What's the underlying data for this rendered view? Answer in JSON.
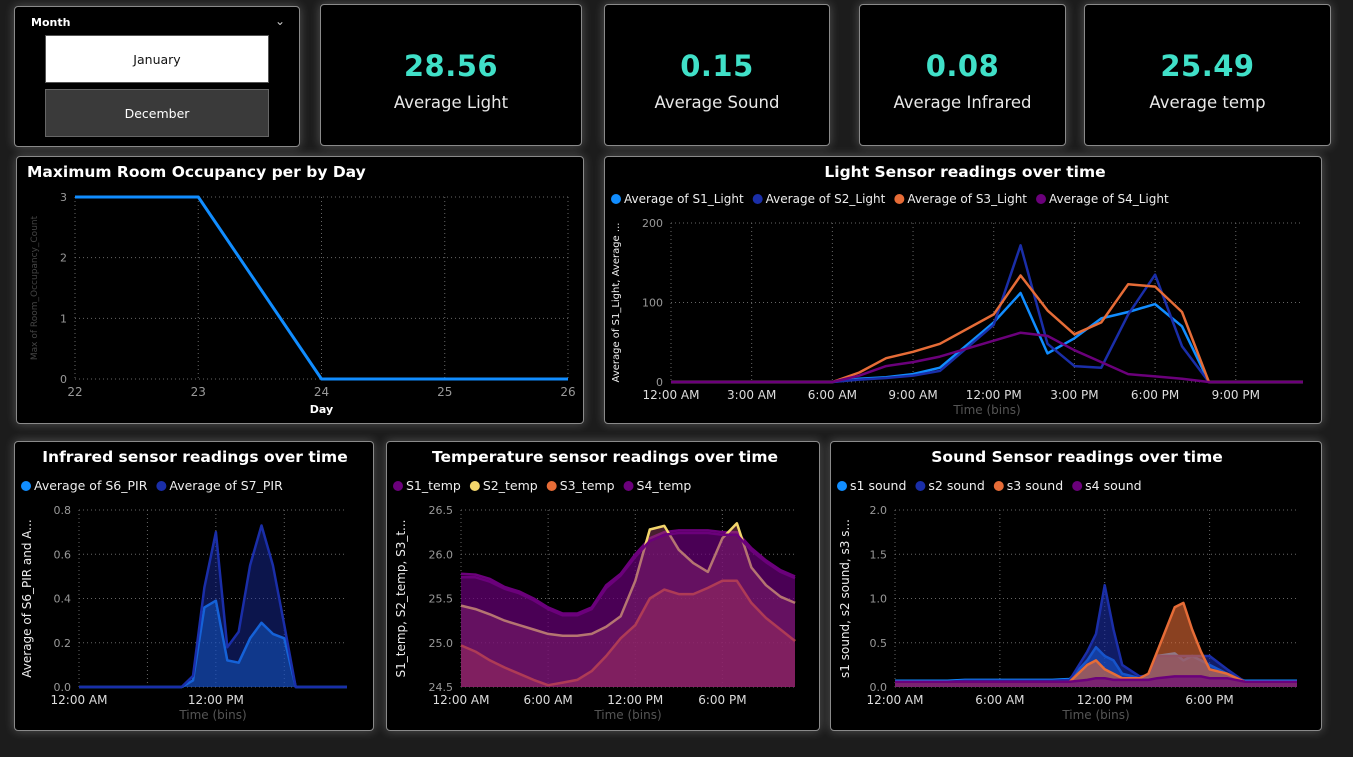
{
  "slicer": {
    "title": "Month",
    "options": [
      "January",
      "December"
    ],
    "selected": "January"
  },
  "kpis": [
    {
      "value": "28.56",
      "label": "Average Light"
    },
    {
      "value": "0.15",
      "label": "Average Sound"
    },
    {
      "value": "0.08",
      "label": "Average Infrared"
    },
    {
      "value": "25.49",
      "label": "Average temp"
    }
  ],
  "colors": {
    "kpi": "#40e0c8",
    "s1": "#118dff",
    "s2": "#1a2ea8",
    "s3": "#e66c37",
    "s4": "#6b007b",
    "temp2": "#f3d66b"
  },
  "chart_data": [
    {
      "type": "line",
      "title": "Maximum Room Occupancy per by Day",
      "xlabel": "Day",
      "ylabel": "Max of Room_Occupancy_Count",
      "x": [
        22,
        23,
        24,
        25,
        26
      ],
      "xlim": [
        22,
        26
      ],
      "ylim": [
        0,
        3
      ],
      "yticks": [
        0,
        1,
        2,
        3
      ],
      "series": [
        {
          "values": [
            3,
            3,
            0,
            0,
            0
          ]
        }
      ],
      "grid": true
    },
    {
      "type": "line",
      "title": "Light Sensor readings over time",
      "xlabel": "Time (bins)",
      "ylabel": "Average of S1_Light, Average ...",
      "xticks": [
        "12:00 AM",
        "3:00 AM",
        "6:00 AM",
        "9:00 AM",
        "12:00 PM",
        "3:00 PM",
        "6:00 PM",
        "9:00 PM"
      ],
      "ylim": [
        0,
        200
      ],
      "yticks": [
        0,
        100,
        200
      ],
      "legend": "top-left",
      "x": [
        0,
        2,
        4,
        6,
        7,
        8,
        9,
        10,
        12,
        13,
        14,
        15,
        16,
        17,
        18,
        19,
        20,
        21,
        22,
        23.5
      ],
      "series": [
        {
          "name": "Average of S1_Light",
          "values": [
            0,
            0,
            0,
            0,
            4,
            6,
            10,
            18,
            75,
            112,
            36,
            55,
            80,
            88,
            98,
            70,
            0,
            0,
            0,
            0
          ]
        },
        {
          "name": "Average of S2_Light",
          "values": [
            0,
            0,
            0,
            0,
            3,
            5,
            8,
            14,
            72,
            172,
            48,
            20,
            18,
            85,
            135,
            45,
            0,
            0,
            0,
            0
          ]
        },
        {
          "name": "Average of S3_Light",
          "values": [
            0,
            0,
            0,
            0,
            12,
            30,
            38,
            48,
            85,
            134,
            90,
            60,
            75,
            123,
            120,
            88,
            0,
            0,
            0,
            0
          ]
        },
        {
          "name": "Average of S4_Light",
          "values": [
            0,
            0,
            0,
            0,
            8,
            20,
            25,
            32,
            52,
            62,
            58,
            40,
            25,
            10,
            7,
            4,
            0,
            0,
            0,
            0
          ]
        }
      ]
    },
    {
      "type": "area",
      "title": "Infrared sensor readings over time",
      "xlabel": "Time (bins)",
      "ylabel": "Average of S6_PIR and A...",
      "xticks": [
        "12:00 AM",
        "12:00 PM"
      ],
      "ylim": [
        0,
        0.8
      ],
      "yticks": [
        0,
        0.2,
        0.4,
        0.6,
        0.8
      ],
      "legend": "top-left",
      "x": [
        0,
        2,
        4,
        6,
        8,
        9,
        10,
        11,
        12,
        13,
        14,
        15,
        16,
        17,
        18,
        19,
        20,
        22,
        23.5
      ],
      "series": [
        {
          "name": "Average of S6_PIR",
          "values": [
            0,
            0,
            0,
            0,
            0,
            0,
            0.03,
            0.36,
            0.39,
            0.12,
            0.11,
            0.22,
            0.29,
            0.24,
            0.22,
            0,
            0,
            0,
            0
          ]
        },
        {
          "name": "Average of S7_PIR",
          "values": [
            0,
            0,
            0,
            0,
            0,
            0,
            0.05,
            0.45,
            0.7,
            0.18,
            0.25,
            0.55,
            0.73,
            0.55,
            0.28,
            0,
            0,
            0,
            0
          ]
        }
      ]
    },
    {
      "type": "area",
      "title": "Temperature sensor readings over time",
      "xlabel": "Time (bins)",
      "ylabel": "S1_temp, S2_temp, S3_t...",
      "xticks": [
        "12:00 AM",
        "6:00 AM",
        "12:00 PM",
        "6:00 PM"
      ],
      "ylim": [
        24.5,
        26.5
      ],
      "yticks": [
        24.5,
        25.0,
        25.5,
        26.0,
        26.5
      ],
      "legend": "top-left",
      "x": [
        0,
        1,
        2,
        3,
        4,
        5,
        6,
        7,
        8,
        9,
        10,
        11,
        12,
        13,
        14,
        15,
        16,
        17,
        18,
        19,
        20,
        21,
        22,
        23
      ],
      "series": [
        {
          "name": "S1_temp",
          "values": [
            25.78,
            25.77,
            25.72,
            25.63,
            25.58,
            25.5,
            25.4,
            25.33,
            25.33,
            25.4,
            25.65,
            25.78,
            26.0,
            26.18,
            26.25,
            26.27,
            26.27,
            26.27,
            26.25,
            26.25,
            26.07,
            25.93,
            25.82,
            25.75
          ]
        },
        {
          "name": "S2_temp",
          "values": [
            25.42,
            25.38,
            25.32,
            25.25,
            25.2,
            25.15,
            25.1,
            25.08,
            25.08,
            25.1,
            25.18,
            25.3,
            25.7,
            26.28,
            26.32,
            26.05,
            25.9,
            25.8,
            26.18,
            26.35,
            25.85,
            25.65,
            25.52,
            25.45
          ]
        },
        {
          "name": "S3_temp",
          "values": [
            24.97,
            24.9,
            24.8,
            24.72,
            24.65,
            24.58,
            24.52,
            24.55,
            24.58,
            24.68,
            24.85,
            25.05,
            25.2,
            25.5,
            25.6,
            25.55,
            25.55,
            25.62,
            25.7,
            25.7,
            25.45,
            25.28,
            25.15,
            25.02
          ]
        },
        {
          "name": "S4_temp",
          "values": [
            25.74,
            25.74,
            25.69,
            25.61,
            25.56,
            25.48,
            25.38,
            25.31,
            25.31,
            25.38,
            25.62,
            25.76,
            25.97,
            26.15,
            26.22,
            26.24,
            26.24,
            26.24,
            26.22,
            26.22,
            26.04,
            25.91,
            25.8,
            25.73
          ]
        }
      ]
    },
    {
      "type": "area",
      "title": "Sound Sensor readings over time",
      "xlabel": "Time (bins)",
      "ylabel": "s1 sound, s2 sound, s3 s...",
      "xticks": [
        "12:00 AM",
        "6:00 AM",
        "12:00 PM",
        "6:00 PM"
      ],
      "ylim": [
        0,
        2.0
      ],
      "yticks": [
        0.0,
        0.5,
        1.0,
        1.5,
        2.0
      ],
      "legend": "top-left",
      "x": [
        0,
        1,
        2,
        3,
        4,
        5,
        6,
        7,
        8,
        9,
        10,
        11,
        11.5,
        12,
        12.5,
        13,
        14,
        14.5,
        15,
        16,
        16.5,
        17,
        17.5,
        18,
        19,
        20,
        21,
        22,
        23
      ],
      "series": [
        {
          "name": "s1 sound",
          "values": [
            0.07,
            0.07,
            0.07,
            0.07,
            0.08,
            0.08,
            0.08,
            0.08,
            0.08,
            0.08,
            0.09,
            0.3,
            0.45,
            0.35,
            0.3,
            0.15,
            0.1,
            0.12,
            0.35,
            0.38,
            0.3,
            0.35,
            0.3,
            0.25,
            0.15,
            0.07,
            0.07,
            0.07,
            0.07
          ]
        },
        {
          "name": "s2 sound",
          "values": [
            0.06,
            0.06,
            0.06,
            0.06,
            0.07,
            0.07,
            0.07,
            0.07,
            0.07,
            0.07,
            0.08,
            0.4,
            0.6,
            1.15,
            0.65,
            0.25,
            0.12,
            0.13,
            0.35,
            0.35,
            0.35,
            0.35,
            0.35,
            0.35,
            0.2,
            0.06,
            0.06,
            0.06,
            0.06
          ]
        },
        {
          "name": "s3 sound",
          "values": [
            0.06,
            0.06,
            0.06,
            0.06,
            0.06,
            0.06,
            0.06,
            0.06,
            0.06,
            0.06,
            0.06,
            0.25,
            0.3,
            0.2,
            0.15,
            0.1,
            0.1,
            0.15,
            0.4,
            0.9,
            0.95,
            0.65,
            0.4,
            0.2,
            0.15,
            0.06,
            0.06,
            0.06,
            0.06
          ]
        },
        {
          "name": "s4 sound",
          "values": [
            0.06,
            0.06,
            0.06,
            0.06,
            0.06,
            0.06,
            0.06,
            0.06,
            0.06,
            0.06,
            0.06,
            0.08,
            0.1,
            0.1,
            0.08,
            0.08,
            0.08,
            0.08,
            0.1,
            0.12,
            0.12,
            0.12,
            0.12,
            0.1,
            0.1,
            0.06,
            0.06,
            0.06,
            0.06
          ]
        }
      ]
    }
  ]
}
